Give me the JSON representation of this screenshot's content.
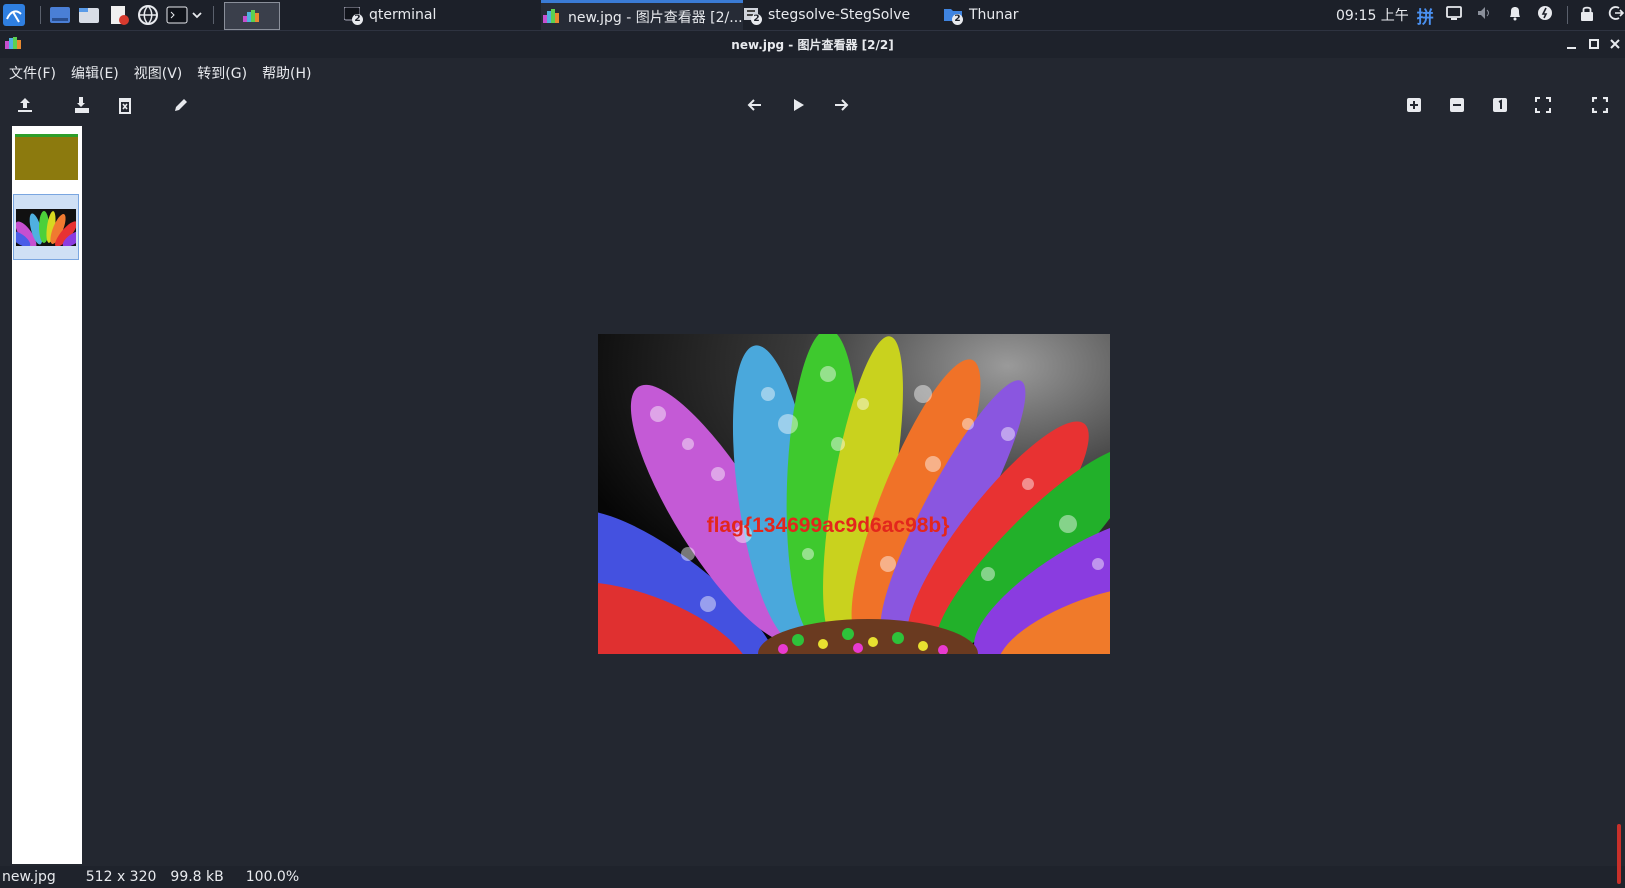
{
  "taskbar": {
    "tasks": [
      {
        "label": "qterminal",
        "badge": "2"
      },
      {
        "label": "new.jpg - 图片查看器 [2/...",
        "badge": ""
      },
      {
        "label": "stegsolve-StegSolve",
        "badge": "2"
      },
      {
        "label": "Thunar",
        "badge": "2"
      }
    ],
    "clock": "09:15 上午",
    "ime": "拼"
  },
  "window": {
    "title": "new.jpg - 图片查看器 [2/2]"
  },
  "menu": {
    "file": "文件(F)",
    "edit": "编辑(E)",
    "view": "视图(V)",
    "go": "转到(G)",
    "help": "帮助(H)"
  },
  "image": {
    "overlay_text": "flag{134699ac9d6ac98b}"
  },
  "status": {
    "filename": "new.jpg",
    "dimensions": "512 x 320",
    "filesize": "99.8 kB",
    "zoom": "100.0%"
  },
  "colors": {
    "accent": "#3a7bd5",
    "background": "#232730",
    "flag_text": "#e3261c"
  }
}
